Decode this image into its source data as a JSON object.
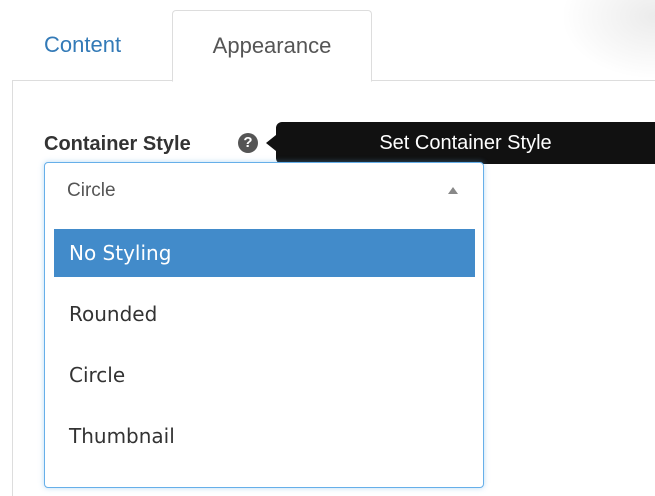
{
  "tabs": [
    {
      "label": "Content"
    },
    {
      "label": "Appearance"
    }
  ],
  "field": {
    "label": "Container Style",
    "help_symbol": "?",
    "tooltip": "Set Container Style"
  },
  "select": {
    "value": "Circle",
    "options": [
      {
        "label": "No Styling",
        "highlighted": true
      },
      {
        "label": "Rounded"
      },
      {
        "label": "Circle"
      },
      {
        "label": "Thumbnail"
      }
    ]
  },
  "colors": {
    "tab_active_link": "#337ab7",
    "option_highlight": "#428bca",
    "tooltip_bg": "#111111",
    "focus_border": "#66afe9"
  },
  "icons": {
    "help": "question-circle-icon",
    "caret": "caret-up-icon"
  }
}
